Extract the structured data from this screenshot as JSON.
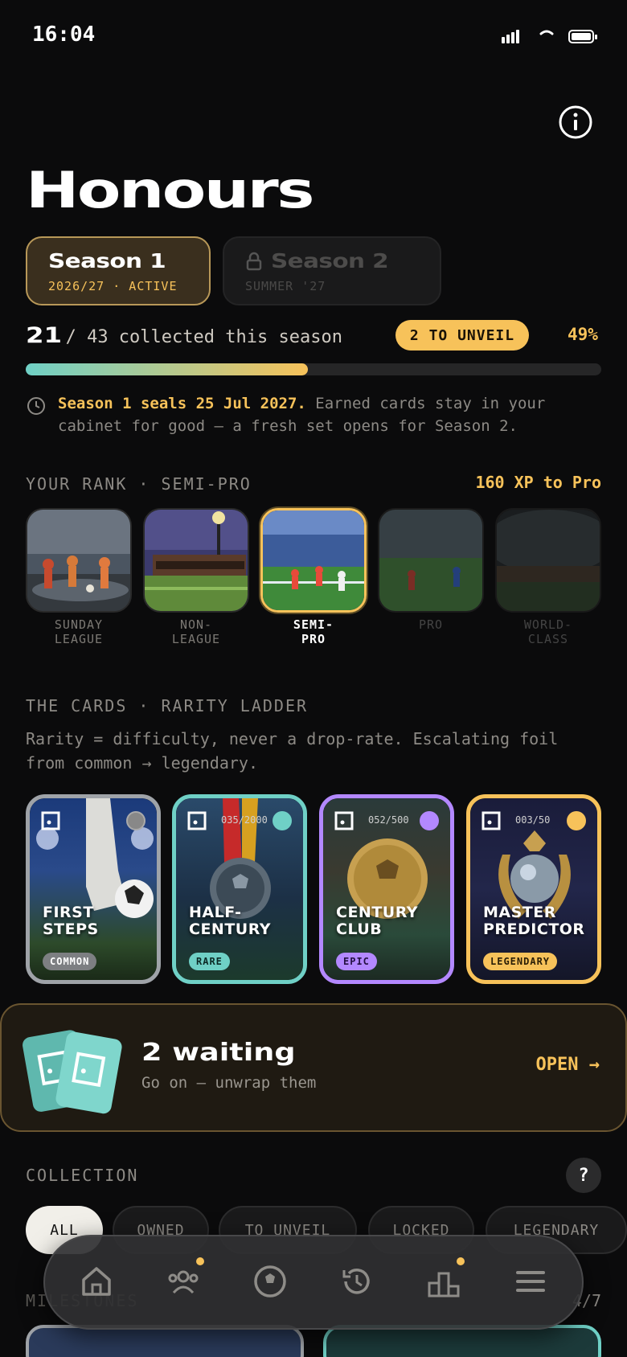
{
  "status": {
    "time": "16:04"
  },
  "header": {
    "title": "Honours",
    "info_icon": "info-icon"
  },
  "seasons": [
    {
      "name": "Season 1",
      "sub": "2026/27 · ACTIVE",
      "state": "active"
    },
    {
      "name": "Season 2",
      "sub": "SUMMER '27",
      "state": "locked"
    }
  ],
  "progress": {
    "collected": "21",
    "total_text": "/ 43 collected this season",
    "unveil_badge": "2 TO UNVEIL",
    "percent_label": "49%",
    "fraction": 0.49
  },
  "notice": {
    "highlight": "Season 1 seals 25 Jul 2027.",
    "text": " Earned cards stay in your cabinet for good — a fresh set opens for Season 2."
  },
  "rank": {
    "heading": "YOUR RANK · SEMI-PRO",
    "xp_to_next": "160 XP to Pro",
    "tiers": [
      {
        "label_1": "SUNDAY",
        "label_2": "LEAGUE"
      },
      {
        "label_1": "NON-",
        "label_2": "LEAGUE"
      },
      {
        "label_1": "SEMI-",
        "label_2": "PRO"
      },
      {
        "label_1": "PRO",
        "label_2": ""
      },
      {
        "label_1": "WORLD-",
        "label_2": "CLASS"
      }
    ]
  },
  "cards_section": {
    "heading": "THE CARDS · RARITY LADDER",
    "description": "Rarity = difficulty, never a drop-rate. Escalating foil from common → legendary.",
    "cards": [
      {
        "title_1": "FIRST",
        "title_2": "STEPS",
        "badge": "COMMON",
        "serial": ""
      },
      {
        "title_1": "HALF-",
        "title_2": "CENTURY",
        "badge": "RARE",
        "serial": "035/2000"
      },
      {
        "title_1": "CENTURY",
        "title_2": "CLUB",
        "badge": "EPIC",
        "serial": "052/500"
      },
      {
        "title_1": "MASTER",
        "title_2": "PREDICTOR",
        "badge": "LEGENDARY",
        "serial": "003/50"
      }
    ]
  },
  "waiting": {
    "title": "2 waiting",
    "subtitle": "Go on — unwrap them",
    "action": "OPEN →"
  },
  "collection": {
    "heading": "COLLECTION",
    "help_icon": "?",
    "filters": [
      "ALL",
      "OWNED",
      "TO UNVEIL",
      "LOCKED",
      "LEGENDARY"
    ]
  },
  "milestones": {
    "heading": "MILESTONES",
    "count": "4/7"
  },
  "colors": {
    "accent_gold": "#f7c25a",
    "teal": "#6fd0c6",
    "epic_purple": "#b388ff",
    "background": "#0b0b0c"
  },
  "nav": [
    "home-icon",
    "friends-icon",
    "ball-icon",
    "history-icon",
    "leaderboard-icon",
    "menu-icon"
  ]
}
